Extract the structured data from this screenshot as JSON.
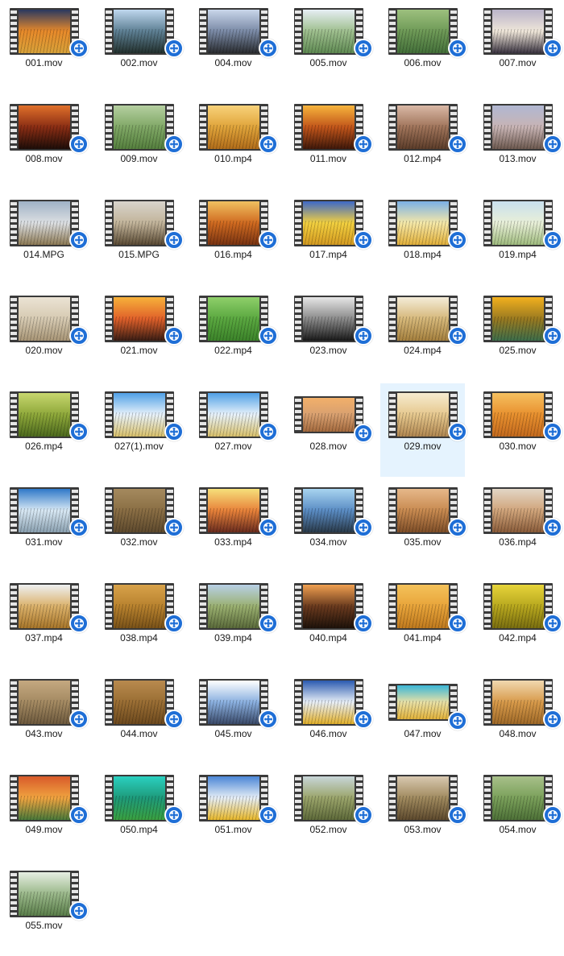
{
  "files": [
    {
      "name": "001.mov",
      "colors": [
        "#2a3960",
        "#e88a2a",
        "#d8a23a"
      ]
    },
    {
      "name": "002.mov",
      "colors": [
        "#bfd7ee",
        "#5d7f93",
        "#23312e"
      ]
    },
    {
      "name": "004.mov",
      "colors": [
        "#c9d6ea",
        "#7a8aa6",
        "#2a2c30"
      ]
    },
    {
      "name": "005.mov",
      "colors": [
        "#e6eef4",
        "#9ebf8e",
        "#5f8a53"
      ]
    },
    {
      "name": "006.mov",
      "colors": [
        "#9dc07e",
        "#6e9a57",
        "#44703a"
      ]
    },
    {
      "name": "007.mov",
      "colors": [
        "#b9b3c9",
        "#efe6d9",
        "#3a3340"
      ]
    },
    {
      "name": "008.mov",
      "colors": [
        "#e0702a",
        "#8a2d14",
        "#1e0d08"
      ]
    },
    {
      "name": "009.mov",
      "colors": [
        "#b5cfa0",
        "#80a866",
        "#55803e"
      ]
    },
    {
      "name": "010.mp4",
      "colors": [
        "#f8d27a",
        "#e0a43a",
        "#b26d1a"
      ]
    },
    {
      "name": "011.mov",
      "colors": [
        "#f6b43c",
        "#c2551a",
        "#40180a"
      ]
    },
    {
      "name": "012.mp4",
      "colors": [
        "#d9b8a6",
        "#a0745a",
        "#5c3d2a"
      ]
    },
    {
      "name": "013.mov",
      "colors": [
        "#b0b7d2",
        "#c8b4b4",
        "#6e5a50"
      ]
    },
    {
      "name": "014.MPG",
      "colors": [
        "#9fb2c6",
        "#dcdfe2",
        "#8d7a55"
      ]
    },
    {
      "name": "015.MPG",
      "colors": [
        "#d8d4cc",
        "#c2b49a",
        "#5a4a34"
      ]
    },
    {
      "name": "016.mp4",
      "colors": [
        "#f0c060",
        "#d06a20",
        "#7a3412"
      ]
    },
    {
      "name": "017.mp4",
      "colors": [
        "#3d68c8",
        "#f2d040",
        "#d49a20"
      ]
    },
    {
      "name": "018.mp4",
      "colors": [
        "#7ab0e6",
        "#f5e8a8",
        "#e2b03a"
      ]
    },
    {
      "name": "019.mp4",
      "colors": [
        "#c9e0ee",
        "#e8efd8",
        "#9fbb7e"
      ]
    },
    {
      "name": "020.mov",
      "colors": [
        "#ebe3d4",
        "#d6cab2",
        "#a89576"
      ]
    },
    {
      "name": "021.mov",
      "colors": [
        "#f7b13a",
        "#e0602a",
        "#3a1d14"
      ]
    },
    {
      "name": "022.mp4",
      "colors": [
        "#8fcf6a",
        "#5aa840",
        "#3c842a"
      ]
    },
    {
      "name": "023.mov",
      "colors": [
        "#e6e6e6",
        "#8a8a8a",
        "#1a1a1a"
      ]
    },
    {
      "name": "024.mp4",
      "colors": [
        "#f4ecd8",
        "#d6b87a",
        "#a5803e"
      ]
    },
    {
      "name": "025.mov",
      "colors": [
        "#f2b01e",
        "#9a7a20",
        "#3d6e4a"
      ]
    },
    {
      "name": "026.mp4",
      "colors": [
        "#c7d66e",
        "#8ea83a",
        "#4d6a1e"
      ]
    },
    {
      "name": "027(1).mov",
      "colors": [
        "#4fa0e6",
        "#e8f2fa",
        "#d8c06a"
      ]
    },
    {
      "name": "027.mov",
      "colors": [
        "#4fa0e6",
        "#e8f2fa",
        "#d8c06a"
      ]
    },
    {
      "name": "028.mov",
      "colors": [
        "#f2b06a",
        "#d8a070",
        "#a46a3e"
      ]
    },
    {
      "name": "029.mov",
      "colors": [
        "#f6ecd0",
        "#e6c88e",
        "#b08650"
      ]
    },
    {
      "name": "030.mov",
      "colors": [
        "#f5c060",
        "#e8902e",
        "#c46a1e"
      ]
    },
    {
      "name": "031.mov",
      "colors": [
        "#2f78c8",
        "#d8e8f4",
        "#8aa0b0"
      ]
    },
    {
      "name": "032.mov",
      "colors": [
        "#a58a5e",
        "#8a6e44",
        "#5e4a2e"
      ]
    },
    {
      "name": "033.mp4",
      "colors": [
        "#f6e07a",
        "#e8823a",
        "#6a2c1e"
      ]
    },
    {
      "name": "034.mov",
      "colors": [
        "#a8d4f0",
        "#5a8cc4",
        "#2a3a4a"
      ]
    },
    {
      "name": "035.mov",
      "colors": [
        "#e6b88a",
        "#c88a50",
        "#7e4e28"
      ]
    },
    {
      "name": "036.mp4",
      "colors": [
        "#e2d6c6",
        "#d0a47a",
        "#8a5c3a"
      ]
    },
    {
      "name": "037.mp4",
      "colors": [
        "#eef0f2",
        "#dbb16a",
        "#a8762a"
      ]
    },
    {
      "name": "038.mp4",
      "colors": [
        "#d8a24a",
        "#b8822e",
        "#7a5218"
      ]
    },
    {
      "name": "039.mp4",
      "colors": [
        "#b8d0e6",
        "#9ab070",
        "#5a6a3a"
      ]
    },
    {
      "name": "040.mp4",
      "colors": [
        "#f0a050",
        "#6a3a1e",
        "#1e120a"
      ]
    },
    {
      "name": "041.mp4",
      "colors": [
        "#f4c25a",
        "#e8a43a",
        "#c07a1e"
      ]
    },
    {
      "name": "042.mp4",
      "colors": [
        "#e6d43a",
        "#b8a81e",
        "#7a6e10"
      ]
    },
    {
      "name": "043.mov",
      "colors": [
        "#c4a880",
        "#a48a62",
        "#6e5a3e"
      ]
    },
    {
      "name": "044.mov",
      "colors": [
        "#b88a4e",
        "#9a6e34",
        "#6e4a1e"
      ]
    },
    {
      "name": "045.mov",
      "colors": [
        "#ffffff",
        "#8ab0e0",
        "#3a4a6a"
      ]
    },
    {
      "name": "046.mov",
      "colors": [
        "#2a5ab0",
        "#e8eef6",
        "#e2b02a"
      ]
    },
    {
      "name": "047.mov",
      "colors": [
        "#3ab6d6",
        "#e8e0a6",
        "#e2b23a"
      ]
    },
    {
      "name": "048.mov",
      "colors": [
        "#f0d8b0",
        "#d89a4a",
        "#a06a28"
      ]
    },
    {
      "name": "049.mov",
      "colors": [
        "#d85a2a",
        "#f0a440",
        "#4a7a3a"
      ]
    },
    {
      "name": "050.mp4",
      "colors": [
        "#2ad0c0",
        "#1e9a7a",
        "#3aa040"
      ]
    },
    {
      "name": "051.mov",
      "colors": [
        "#4a86d6",
        "#e6eef6",
        "#e8b82a"
      ]
    },
    {
      "name": "052.mov",
      "colors": [
        "#c8d6d8",
        "#9aa46a",
        "#5e6a3a"
      ]
    },
    {
      "name": "053.mov",
      "colors": [
        "#d8c8b0",
        "#a08a5e",
        "#5e4a2e"
      ]
    },
    {
      "name": "054.mov",
      "colors": [
        "#a8c08a",
        "#7aa05a",
        "#4e7238"
      ]
    },
    {
      "name": "055.mov",
      "colors": [
        "#e6eee2",
        "#9ab88a",
        "#5a7e4a"
      ]
    }
  ]
}
